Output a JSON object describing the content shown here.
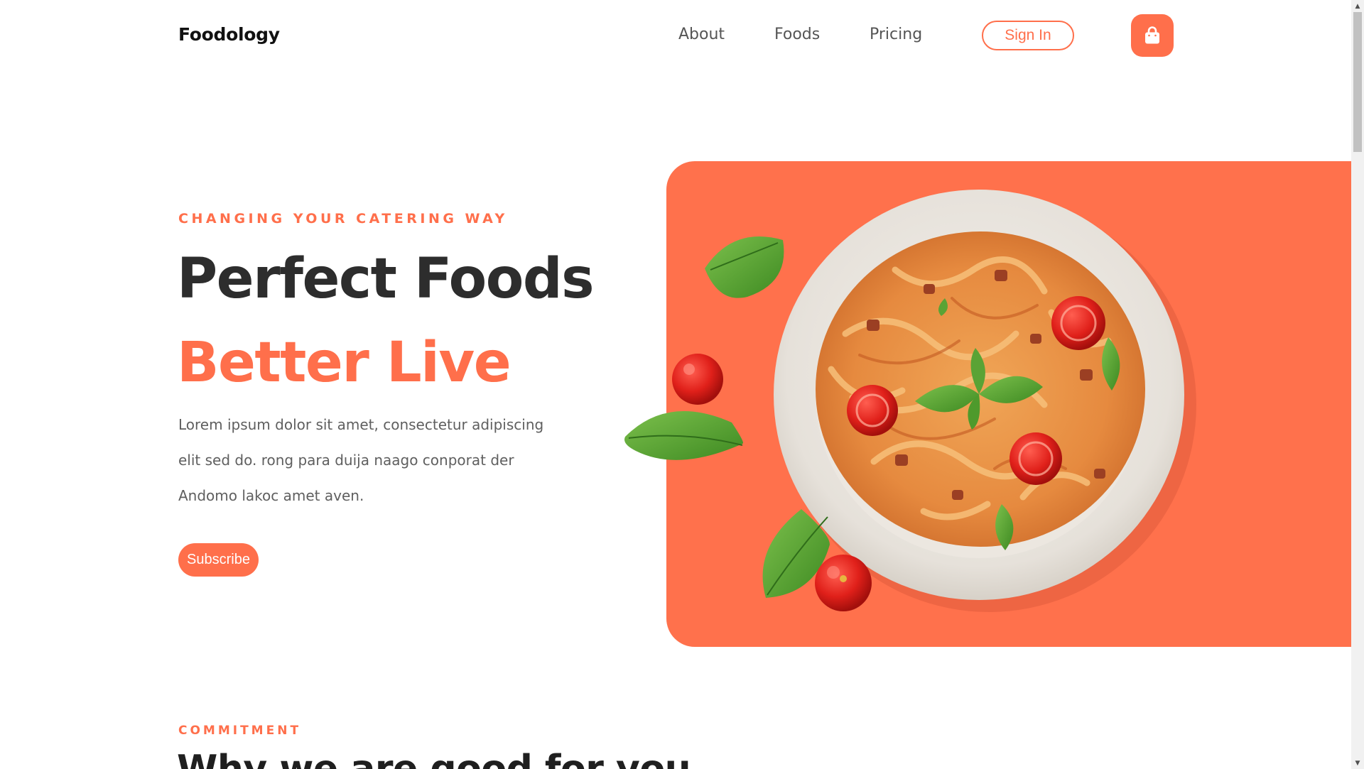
{
  "header": {
    "logo": "Foodology",
    "nav": [
      "About",
      "Foods",
      "Pricing"
    ],
    "sign_in": "Sign In",
    "cart_icon": "shopping-bag-icon"
  },
  "hero": {
    "eyebrow": "CHANGING YOUR CATERING WAY",
    "title_line1": "Perfect Foods",
    "title_line2": "Better Live",
    "description": [
      "Lorem ipsum dolor sit amet, consectetur adipiscing",
      "elit sed do. rong para duija naago conporat der",
      "Andomo lakoc amet aven."
    ],
    "cta": "Subscribe",
    "image": "pasta-plate-with-basil-and-tomatoes"
  },
  "section": {
    "eyebrow": "COMMITMENT",
    "title": "Why we are good for you"
  },
  "colors": {
    "accent": "#ff6f4b",
    "heading": "#2d2d2d",
    "body": "#5f5f5f"
  }
}
